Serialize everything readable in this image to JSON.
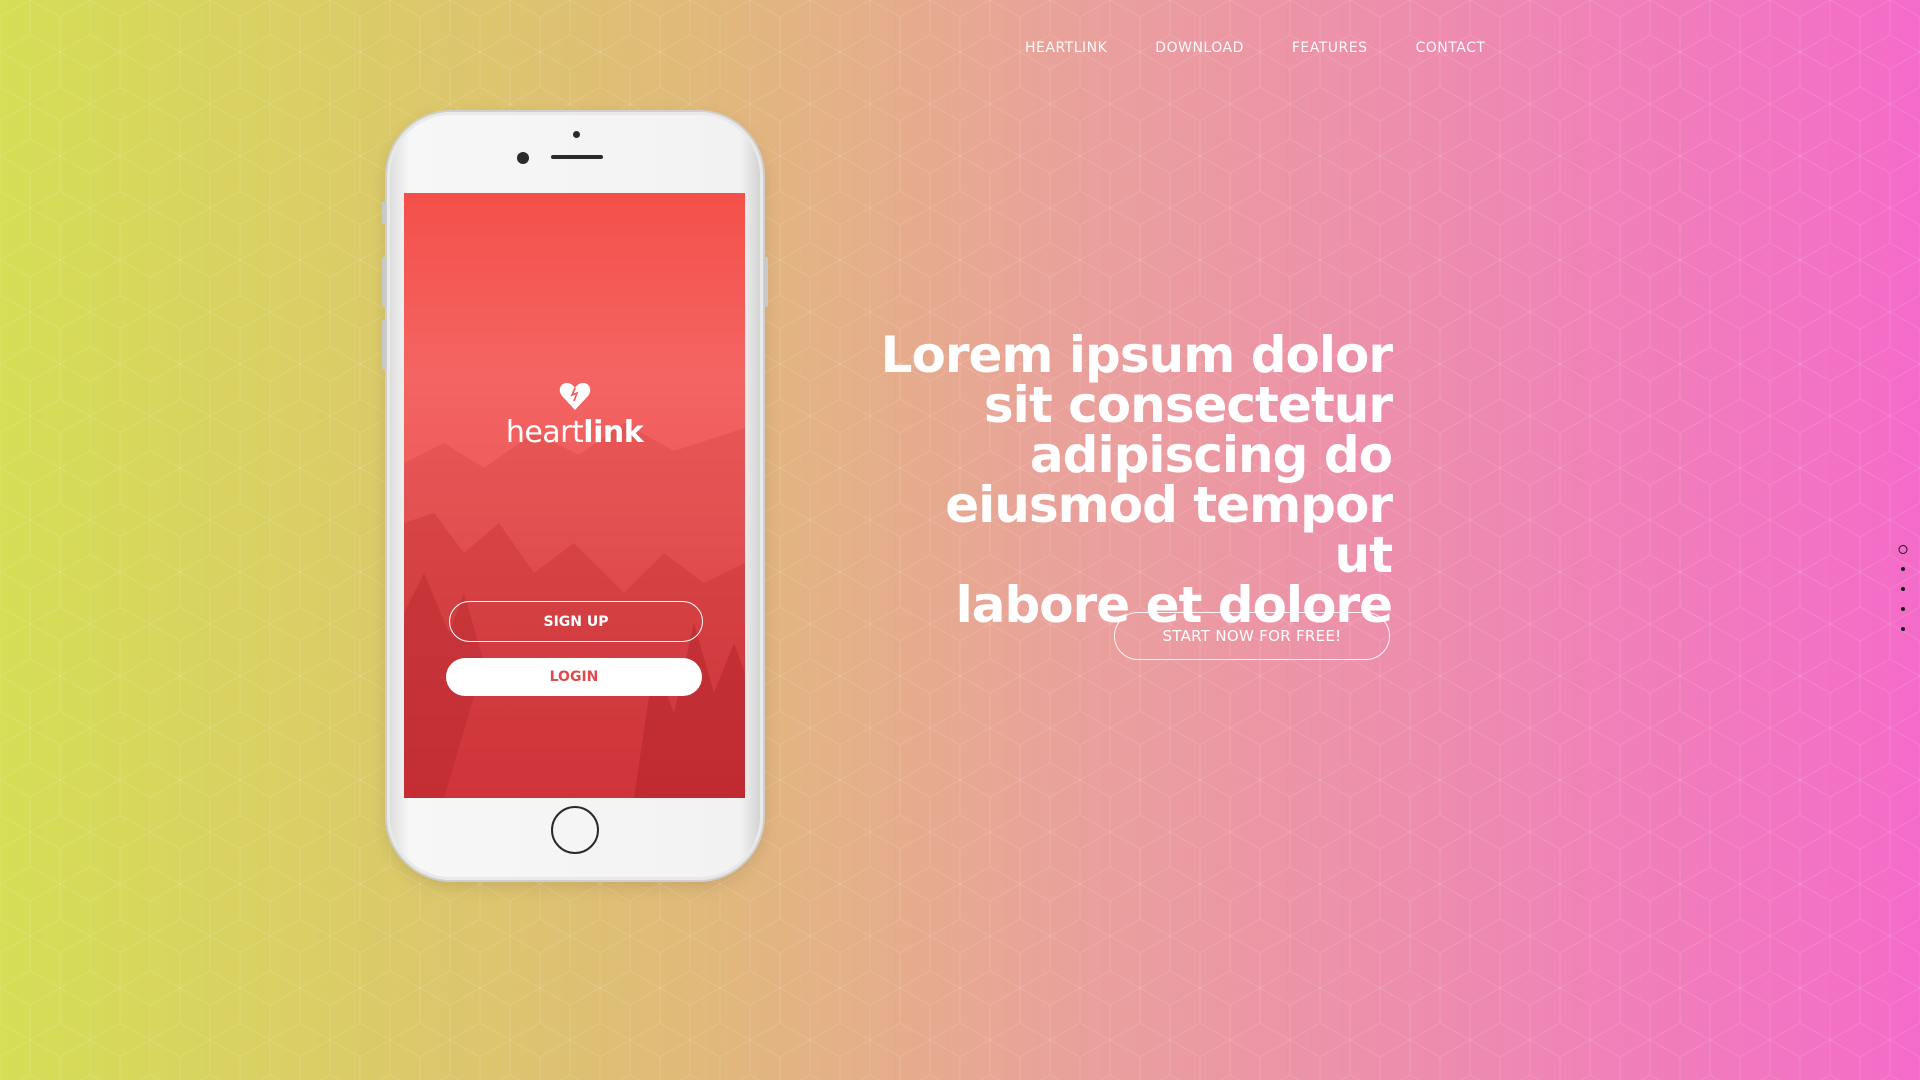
{
  "nav": {
    "items": [
      {
        "label": "HEARTLINK"
      },
      {
        "label": "DOWNLOAD"
      },
      {
        "label": "FEATURES"
      },
      {
        "label": "CONTACT"
      }
    ]
  },
  "hero": {
    "headline_lines": [
      "Lorem ipsum dolor",
      "sit consectetur",
      "adipiscing do",
      "eiusmod tempor ut",
      "labore et dolore"
    ],
    "cta_label": "START NOW FOR FREE!"
  },
  "side_nav": {
    "active_index": 0,
    "count": 5
  },
  "phone": {
    "app_name_light": "heart",
    "app_name_bold": "link",
    "signup_label": "SIGN UP",
    "login_label": "LOGIN",
    "logo_icon": "heart-icon"
  },
  "colors": {
    "gradient_left": "#d5de55",
    "gradient_right": "#f46bc9",
    "screen_top": "#f4504a",
    "login_text": "#e14a4c"
  }
}
